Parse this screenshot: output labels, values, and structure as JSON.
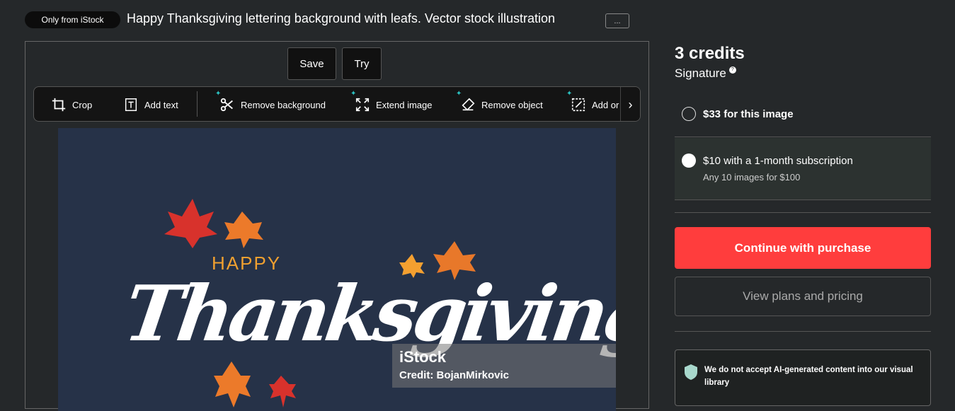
{
  "header": {
    "badge": "Only from iStock",
    "title": "Happy Thanksgiving lettering background with leafs. Vector stock illustration",
    "more_label": "..."
  },
  "editor": {
    "save_label": "Save",
    "try_label": "Try",
    "tools": [
      {
        "label": "Crop",
        "icon": "crop-icon"
      },
      {
        "label": "Add text",
        "icon": "text-icon"
      },
      {
        "label": "Remove background",
        "icon": "scissors-icon"
      },
      {
        "label": "Extend image",
        "icon": "expand-icon"
      },
      {
        "label": "Remove object",
        "icon": "eraser-icon"
      },
      {
        "label": "Add or",
        "icon": "edit-icon"
      }
    ]
  },
  "image": {
    "happy": "HAPPY",
    "thanksgiving": "Thanksgiving",
    "watermark": "iStock",
    "credit": "Credit: BojanMirkovic"
  },
  "pricing": {
    "credits": "3 credits",
    "tier": "Signature",
    "options": [
      {
        "label": "$33 for this image",
        "selected": false
      },
      {
        "label": "$10 with a 1-month subscription",
        "sub": "Any 10 images for $100",
        "selected": true
      }
    ],
    "continue_label": "Continue with purchase",
    "plans_label": "View plans and pricing",
    "ai_notice": "We do not accept AI-generated content into our visual library"
  },
  "colors": {
    "accent": "#ff3d3d",
    "bg": "#25282a"
  }
}
